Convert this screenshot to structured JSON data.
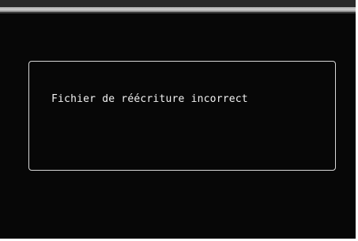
{
  "dialog": {
    "message": "Fichier de réécriture incorrect"
  },
  "colors": {
    "background": "#070707",
    "text": "#f2f2f2",
    "dialog_border": "#d8d8d8",
    "top_band": "#cfcfcf"
  }
}
